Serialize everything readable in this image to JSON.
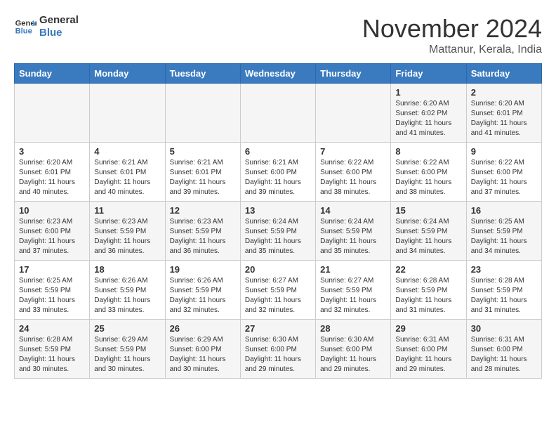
{
  "logo": {
    "line1": "General",
    "line2": "Blue"
  },
  "title": "November 2024",
  "location": "Mattanur, Kerala, India",
  "days_of_week": [
    "Sunday",
    "Monday",
    "Tuesday",
    "Wednesday",
    "Thursday",
    "Friday",
    "Saturday"
  ],
  "weeks": [
    [
      {
        "day": "",
        "info": ""
      },
      {
        "day": "",
        "info": ""
      },
      {
        "day": "",
        "info": ""
      },
      {
        "day": "",
        "info": ""
      },
      {
        "day": "",
        "info": ""
      },
      {
        "day": "1",
        "info": "Sunrise: 6:20 AM\nSunset: 6:02 PM\nDaylight: 11 hours\nand 41 minutes."
      },
      {
        "day": "2",
        "info": "Sunrise: 6:20 AM\nSunset: 6:01 PM\nDaylight: 11 hours\nand 41 minutes."
      }
    ],
    [
      {
        "day": "3",
        "info": "Sunrise: 6:20 AM\nSunset: 6:01 PM\nDaylight: 11 hours\nand 40 minutes."
      },
      {
        "day": "4",
        "info": "Sunrise: 6:21 AM\nSunset: 6:01 PM\nDaylight: 11 hours\nand 40 minutes."
      },
      {
        "day": "5",
        "info": "Sunrise: 6:21 AM\nSunset: 6:01 PM\nDaylight: 11 hours\nand 39 minutes."
      },
      {
        "day": "6",
        "info": "Sunrise: 6:21 AM\nSunset: 6:00 PM\nDaylight: 11 hours\nand 39 minutes."
      },
      {
        "day": "7",
        "info": "Sunrise: 6:22 AM\nSunset: 6:00 PM\nDaylight: 11 hours\nand 38 minutes."
      },
      {
        "day": "8",
        "info": "Sunrise: 6:22 AM\nSunset: 6:00 PM\nDaylight: 11 hours\nand 38 minutes."
      },
      {
        "day": "9",
        "info": "Sunrise: 6:22 AM\nSunset: 6:00 PM\nDaylight: 11 hours\nand 37 minutes."
      }
    ],
    [
      {
        "day": "10",
        "info": "Sunrise: 6:23 AM\nSunset: 6:00 PM\nDaylight: 11 hours\nand 37 minutes."
      },
      {
        "day": "11",
        "info": "Sunrise: 6:23 AM\nSunset: 5:59 PM\nDaylight: 11 hours\nand 36 minutes."
      },
      {
        "day": "12",
        "info": "Sunrise: 6:23 AM\nSunset: 5:59 PM\nDaylight: 11 hours\nand 36 minutes."
      },
      {
        "day": "13",
        "info": "Sunrise: 6:24 AM\nSunset: 5:59 PM\nDaylight: 11 hours\nand 35 minutes."
      },
      {
        "day": "14",
        "info": "Sunrise: 6:24 AM\nSunset: 5:59 PM\nDaylight: 11 hours\nand 35 minutes."
      },
      {
        "day": "15",
        "info": "Sunrise: 6:24 AM\nSunset: 5:59 PM\nDaylight: 11 hours\nand 34 minutes."
      },
      {
        "day": "16",
        "info": "Sunrise: 6:25 AM\nSunset: 5:59 PM\nDaylight: 11 hours\nand 34 minutes."
      }
    ],
    [
      {
        "day": "17",
        "info": "Sunrise: 6:25 AM\nSunset: 5:59 PM\nDaylight: 11 hours\nand 33 minutes."
      },
      {
        "day": "18",
        "info": "Sunrise: 6:26 AM\nSunset: 5:59 PM\nDaylight: 11 hours\nand 33 minutes."
      },
      {
        "day": "19",
        "info": "Sunrise: 6:26 AM\nSunset: 5:59 PM\nDaylight: 11 hours\nand 32 minutes."
      },
      {
        "day": "20",
        "info": "Sunrise: 6:27 AM\nSunset: 5:59 PM\nDaylight: 11 hours\nand 32 minutes."
      },
      {
        "day": "21",
        "info": "Sunrise: 6:27 AM\nSunset: 5:59 PM\nDaylight: 11 hours\nand 32 minutes."
      },
      {
        "day": "22",
        "info": "Sunrise: 6:28 AM\nSunset: 5:59 PM\nDaylight: 11 hours\nand 31 minutes."
      },
      {
        "day": "23",
        "info": "Sunrise: 6:28 AM\nSunset: 5:59 PM\nDaylight: 11 hours\nand 31 minutes."
      }
    ],
    [
      {
        "day": "24",
        "info": "Sunrise: 6:28 AM\nSunset: 5:59 PM\nDaylight: 11 hours\nand 30 minutes."
      },
      {
        "day": "25",
        "info": "Sunrise: 6:29 AM\nSunset: 5:59 PM\nDaylight: 11 hours\nand 30 minutes."
      },
      {
        "day": "26",
        "info": "Sunrise: 6:29 AM\nSunset: 6:00 PM\nDaylight: 11 hours\nand 30 minutes."
      },
      {
        "day": "27",
        "info": "Sunrise: 6:30 AM\nSunset: 6:00 PM\nDaylight: 11 hours\nand 29 minutes."
      },
      {
        "day": "28",
        "info": "Sunrise: 6:30 AM\nSunset: 6:00 PM\nDaylight: 11 hours\nand 29 minutes."
      },
      {
        "day": "29",
        "info": "Sunrise: 6:31 AM\nSunset: 6:00 PM\nDaylight: 11 hours\nand 29 minutes."
      },
      {
        "day": "30",
        "info": "Sunrise: 6:31 AM\nSunset: 6:00 PM\nDaylight: 11 hours\nand 28 minutes."
      }
    ]
  ]
}
